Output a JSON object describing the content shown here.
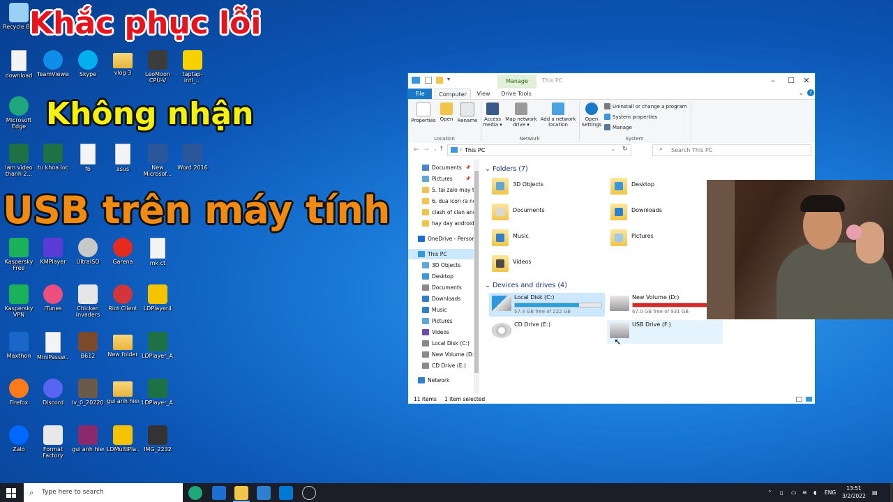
{
  "overlay": {
    "line1": "Khắc phục lỗi",
    "line2": "Không nhận",
    "line3": "USB trên máy tính"
  },
  "desktop_icons": [
    {
      "label": "Recycle Bin",
      "icon": "recycle-bin-icon",
      "color": "#9ad0f5"
    },
    {
      "label": "download",
      "icon": "document-icon",
      "color": "#f0c040"
    },
    {
      "label": "TeamViewer",
      "icon": "teamviewer-icon",
      "color": "#0e8ee9"
    },
    {
      "label": "Skype",
      "icon": "skype-icon",
      "color": "#00aff0"
    },
    {
      "label": "vlog 3",
      "icon": "folder-icon",
      "color": "#f1c54b"
    },
    {
      "label": "LeoMoon CPU-V",
      "icon": "cpu-icon",
      "color": "#3c3c3c"
    },
    {
      "label": "taptap-intl_...",
      "icon": "taptap-icon",
      "color": "#f5d200"
    },
    {
      "label": "Microsoft Edge",
      "icon": "edge-icon",
      "color": "#1ea77b"
    },
    {
      "label": "lam video thanh 2...",
      "icon": "excel-icon",
      "color": "#1e7145"
    },
    {
      "label": "tu khoa loc",
      "icon": "excel-icon",
      "color": "#1e7145"
    },
    {
      "label": "fb",
      "icon": "file-icon",
      "color": "#f4f4f4"
    },
    {
      "label": "asus",
      "icon": "file-icon",
      "color": "#f4f4f4"
    },
    {
      "label": "New Microsof...",
      "icon": "word-icon",
      "color": "#2b579a"
    },
    {
      "label": "Word 2016",
      "icon": "word-icon",
      "color": "#2b579a"
    },
    {
      "label": "Kaspersky Free",
      "icon": "kaspersky-icon",
      "color": "#1bb05a"
    },
    {
      "label": "KMPlayer",
      "icon": "kmplayer-icon",
      "color": "#5b3bd6"
    },
    {
      "label": "UltraISO",
      "icon": "disc-icon",
      "color": "#c8c8c8"
    },
    {
      "label": "Garena",
      "icon": "garena-icon",
      "color": "#e52b1e"
    },
    {
      "label": "mk ct",
      "icon": "file-icon",
      "color": "#f4f4f4"
    },
    {
      "label": "Kaspersky VPN",
      "icon": "vpn-icon",
      "color": "#1bb05a"
    },
    {
      "label": "iTunes",
      "icon": "itunes-icon",
      "color": "#f04e7c"
    },
    {
      "label": "Chicken Invaders",
      "icon": "chicken-icon",
      "color": "#e6e6e6"
    },
    {
      "label": "Riot Client",
      "icon": "riot-icon",
      "color": "#d13639"
    },
    {
      "label": "LDPlayer4",
      "icon": "ldplayer-icon",
      "color": "#f5c300"
    },
    {
      "label": "Maxthon",
      "icon": "maxthon-icon",
      "color": "#1a66c9"
    },
    {
      "label": "MiniPassw...",
      "icon": "file-icon",
      "color": "#f4f4f4"
    },
    {
      "label": "B612",
      "icon": "image-icon",
      "color": "#7a4a2a"
    },
    {
      "label": "New folder",
      "icon": "folder-icon",
      "color": "#f1c54b"
    },
    {
      "label": "LDPlayer_A...",
      "icon": "excel-icon",
      "color": "#1e7145"
    },
    {
      "label": "Firefox",
      "icon": "firefox-icon",
      "color": "#ff7a1a"
    },
    {
      "label": "Discord",
      "icon": "discord-icon",
      "color": "#5865f2"
    },
    {
      "label": "lv_0_20220...",
      "icon": "video-icon",
      "color": "#6b5a4a"
    },
    {
      "label": "gui anh hieu",
      "icon": "folder-icon",
      "color": "#f1c54b"
    },
    {
      "label": "LDPlayer_A...",
      "icon": "excel-icon",
      "color": "#1e7145"
    },
    {
      "label": "Zalo",
      "icon": "zalo-icon",
      "color": "#0068ff"
    },
    {
      "label": "Format Factory",
      "icon": "format-factory-icon",
      "color": "#e8e8e8"
    },
    {
      "label": "gui anh hieu",
      "icon": "winrar-icon",
      "color": "#8b2a6a"
    },
    {
      "label": "LDMultiPla...",
      "icon": "ldmulti-icon",
      "color": "#f5c300"
    },
    {
      "label": "IMG_2232",
      "icon": "image-icon",
      "color": "#333333"
    }
  ],
  "explorer": {
    "title": "This PC",
    "manage_tab": "Manage",
    "tabs": [
      "File",
      "Computer",
      "View",
      "Drive Tools"
    ],
    "ribbon": {
      "location": {
        "label": "Location",
        "buttons": [
          "Properties",
          "Open",
          "Rename"
        ]
      },
      "network": {
        "label": "Network",
        "buttons": [
          "Access media ▾",
          "Map network drive ▾",
          "Add a network location"
        ]
      },
      "system": {
        "label": "System",
        "open_settings": "Open Settings",
        "links": [
          "Uninstall or change a program",
          "System properties",
          "Manage"
        ]
      }
    },
    "address": "This PC",
    "search_placeholder": "Search This PC",
    "nav": [
      {
        "label": "Documents",
        "pinned": true,
        "color": "#4a86c9"
      },
      {
        "label": "Pictures",
        "pinned": true,
        "color": "#5fa6d9"
      },
      {
        "label": "5. tai zalo may ti",
        "color": "#f1c54b"
      },
      {
        "label": "6. dua icon ra ng",
        "color": "#f1c54b"
      },
      {
        "label": "clash of clan anc",
        "color": "#f1c54b"
      },
      {
        "label": "hay day android",
        "color": "#f1c54b"
      },
      {
        "label": "OneDrive - Person",
        "color": "#1d6fd1"
      },
      {
        "label": "This PC",
        "color": "#3a96dd",
        "selected": true
      },
      {
        "label": "3D Objects",
        "color": "#5fa6d9"
      },
      {
        "label": "Desktop",
        "color": "#3a96dd"
      },
      {
        "label": "Documents",
        "color": "#8a8a8a"
      },
      {
        "label": "Downloads",
        "color": "#2f7fd1"
      },
      {
        "label": "Music",
        "color": "#2f7fd1"
      },
      {
        "label": "Pictures",
        "color": "#5fa6d9"
      },
      {
        "label": "Videos",
        "color": "#6b4aa8"
      },
      {
        "label": "Local Disk (C:)",
        "color": "#8a8a8a"
      },
      {
        "label": "New Volume (D:",
        "color": "#8a8a8a"
      },
      {
        "label": "CD Drive (E:)",
        "color": "#8a8a8a"
      },
      {
        "label": "Network",
        "color": "#2f7fd1"
      }
    ],
    "folders_header": "Folders (7)",
    "folders": [
      {
        "name": "3D Objects",
        "badge": "#5fa6d9"
      },
      {
        "name": "Desktop",
        "badge": "#3a96dd"
      },
      {
        "name": "Documents",
        "badge": "#d8d8d8"
      },
      {
        "name": "Downloads",
        "badge": "#2f7fd1"
      },
      {
        "name": "Music",
        "badge": "#2f7fd1"
      },
      {
        "name": "Pictures",
        "badge": "#9ec9e8"
      },
      {
        "name": "Videos",
        "badge": "#4a4a4a"
      }
    ],
    "drives_header": "Devices and drives (4)",
    "drives": [
      {
        "name": "Local Disk (C:)",
        "space": "57.4 GB free of 222 GB",
        "used_fraction": 0.74,
        "bar_color": "#26a0da",
        "selected": true
      },
      {
        "name": "New Volume (D:)",
        "space": "67.0 GB free of 931 GB",
        "used_fraction": 0.93,
        "bar_color": "#da2626"
      },
      {
        "name": "CD Drive (E:)"
      },
      {
        "name": "USB Drive (F:)",
        "hover": true
      }
    ],
    "status": {
      "items": "11 items",
      "selected": "1 item selected"
    }
  },
  "taskbar": {
    "search_placeholder": "Type here to search",
    "language": "ENG",
    "time": "13:51",
    "date": "3/2/2022"
  }
}
